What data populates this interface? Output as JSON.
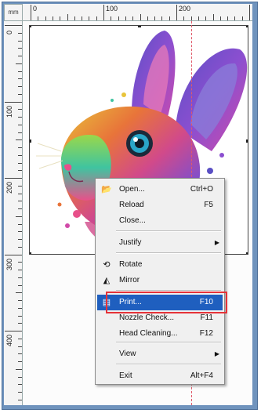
{
  "ruler": {
    "unit": "mm",
    "top_labels": [
      "0",
      "100",
      "200"
    ],
    "left_labels": [
      "0",
      "100",
      "200",
      "300",
      "400"
    ]
  },
  "colors": {
    "frame": "#6f93bd",
    "highlight": "#1f5fbf",
    "callout": "#e53238",
    "guide": "#e05a6a"
  },
  "menu": {
    "items": [
      {
        "label": "Open...",
        "shortcut": "Ctrl+O",
        "icon": "folder-open-icon"
      },
      {
        "label": "Reload",
        "shortcut": "F5"
      },
      {
        "label": "Close...",
        "shortcut": ""
      },
      {
        "label": "Justify",
        "shortcut": "",
        "submenu": true
      },
      {
        "label": "Rotate",
        "shortcut": "",
        "icon": "rotate-icon"
      },
      {
        "label": "Mirror",
        "shortcut": "",
        "icon": "mirror-icon"
      },
      {
        "label": "Print...",
        "shortcut": "F10",
        "icon": "printer-icon",
        "highlighted": true
      },
      {
        "label": "Nozzle Check...",
        "shortcut": "F11"
      },
      {
        "label": "Head Cleaning...",
        "shortcut": "F12"
      },
      {
        "label": "View",
        "shortcut": "",
        "submenu": true
      },
      {
        "label": "Exit",
        "shortcut": "Alt+F4"
      }
    ]
  }
}
